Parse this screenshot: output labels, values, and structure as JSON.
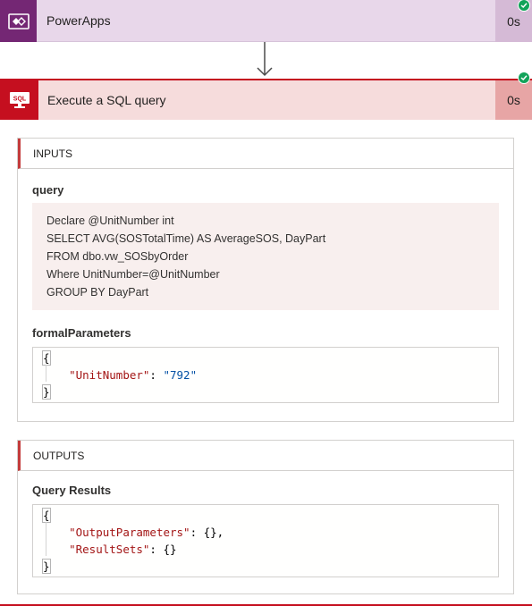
{
  "powerapps_step": {
    "title": "PowerApps",
    "duration": "0s",
    "icon": "powerapps-icon",
    "brand_color": "#742774",
    "status": "succeeded"
  },
  "sql_step": {
    "title": "Execute a SQL query",
    "duration": "0s",
    "icon": "sql-server-icon",
    "brand_color": "#c50f1f",
    "status": "succeeded"
  },
  "inputs": {
    "heading": "INPUTS",
    "query_label": "query",
    "query_lines": [
      "Declare @UnitNumber int",
      "SELECT AVG(SOSTotalTime) AS AverageSOS, DayPart",
      "FROM dbo.vw_SOSbyOrder",
      "Where UnitNumber=@UnitNumber",
      "GROUP BY DayPart"
    ],
    "formal_label": "formalParameters",
    "formal_json": {
      "open": "{",
      "key": "\"UnitNumber\"",
      "colon": ": ",
      "value": "\"792\"",
      "close": "}"
    }
  },
  "outputs": {
    "heading": "OUTPUTS",
    "results_label": "Query Results",
    "results_json": {
      "open": "{",
      "key1": "\"OutputParameters\"",
      "sep1": ": {},",
      "key2": "\"ResultSets\"",
      "sep2": ": {}",
      "close": "}"
    }
  }
}
